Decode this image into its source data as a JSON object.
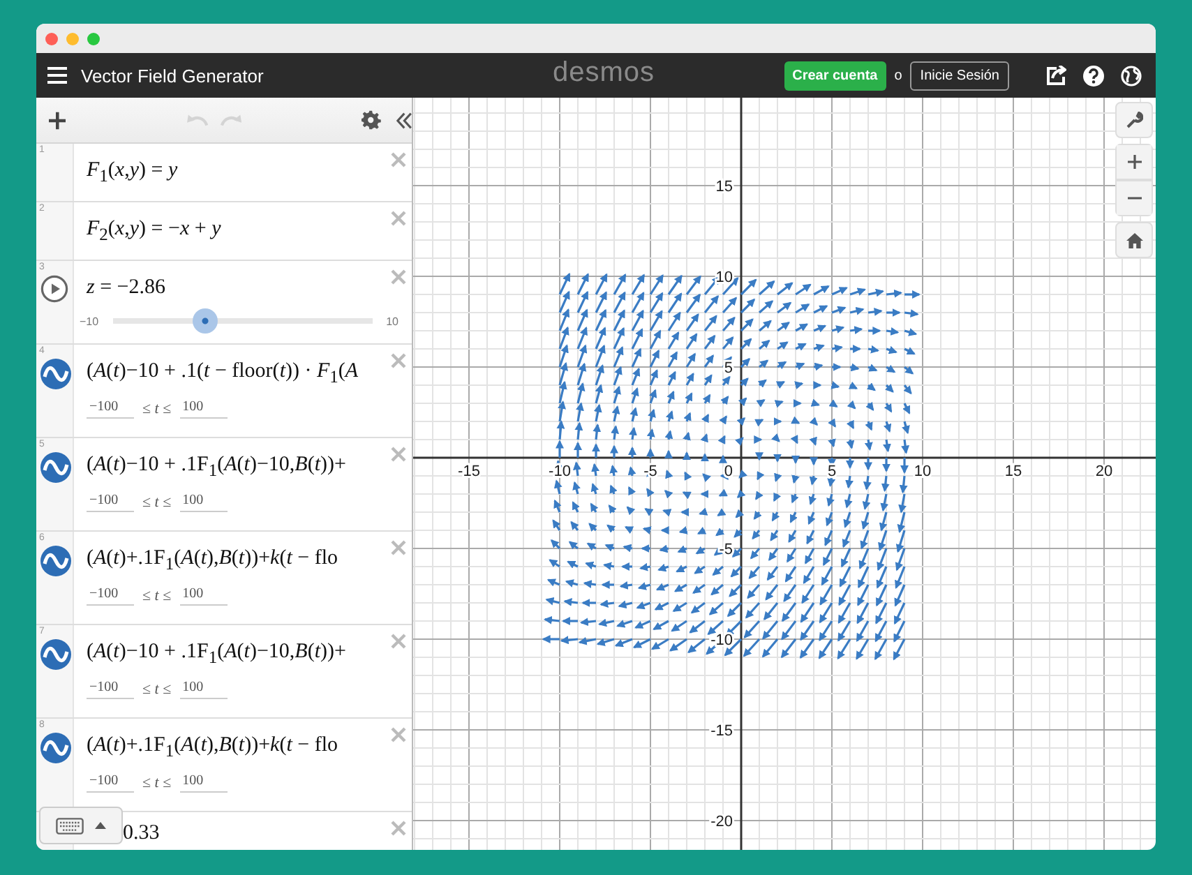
{
  "header": {
    "title": "Vector Field Generator",
    "logo": "desmos",
    "signup": "Crear cuenta",
    "or": "o",
    "login": "Inicie Sesión"
  },
  "toolbar": {
    "undo": {
      "disabled": true
    },
    "redo": {
      "disabled": true
    }
  },
  "expressions": [
    {
      "number": "1",
      "kind": "function",
      "text": "*F*$_{1}$(*x*,*y*) = *y*"
    },
    {
      "number": "2",
      "kind": "function",
      "text": "*F*$_{2}$(*x*,*y*) = −*x* + *y*"
    },
    {
      "number": "3",
      "kind": "slider",
      "text": "*z* = −2.86",
      "min": "−10",
      "max": "10",
      "level": 0.357
    },
    {
      "number": "4",
      "kind": "parametric",
      "text": "(*A*(*t*)−10 + .1(*t* − floor(*t*)) · *F*$_{1}$(*A*",
      "range": {
        "min": "−100",
        "op": "≤ *t* ≤",
        "max": "100"
      }
    },
    {
      "number": "5",
      "kind": "parametric",
      "text": "(*A*(*t*)−10 + .1F$_{1}$(*A*(*t*)−10,*B*(*t*))+",
      "range": {
        "min": "−100",
        "op": "≤ *t* ≤",
        "max": "100"
      }
    },
    {
      "number": "6",
      "kind": "parametric",
      "text": "(*A*(*t*)+.1F$_{1}$(*A*(*t*),*B*(*t*))+*k*(*t* − flo",
      "range": {
        "min": "−100",
        "op": "≤ *t* ≤",
        "max": "100"
      }
    },
    {
      "number": "7",
      "kind": "parametric",
      "text": "(*A*(*t*)−10 + .1F$_{1}$(*A*(*t*)−10,*B*(*t*))+",
      "range": {
        "min": "−100",
        "op": "≤ *t* ≤",
        "max": "100"
      }
    },
    {
      "number": "8",
      "kind": "parametric",
      "text": "(*A*(*t*)+.1F$_{1}$(*A*(*t*),*B*(*t*))+*k*(*t* − flo",
      "range": {
        "min": "−100",
        "op": "≤ *t* ≤",
        "max": "100"
      }
    },
    {
      "kind": "variable",
      "text": "0.33"
    }
  ],
  "graph": {
    "origin_label": "0",
    "x_labels": [
      "-15",
      "-10",
      "-5",
      "5",
      "10",
      "15",
      "20"
    ],
    "y_labels": [
      "15",
      "10",
      "5",
      "-5",
      "-10",
      "-15",
      "-20"
    ]
  }
}
